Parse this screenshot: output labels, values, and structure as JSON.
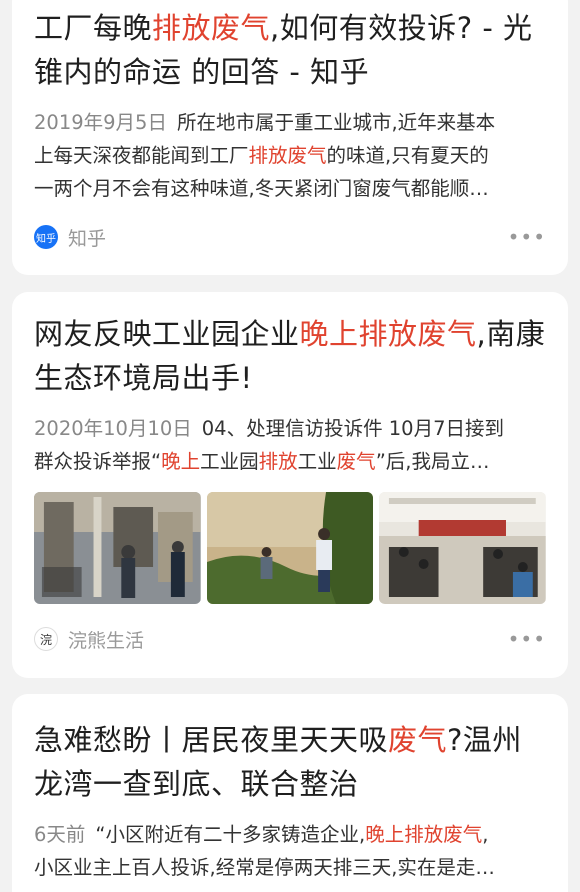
{
  "results": [
    {
      "title_parts": [
        "工厂每晚",
        "排放废气",
        ",如何有效投诉? - 光",
        "锥内的命运 的回答 - 知乎"
      ],
      "date": "2019年9月5日",
      "snippet_lines": [
        [
          "所在地市属于重工业城市,近年来基本"
        ],
        [
          "上每天深夜都能闻到工厂",
          "排放废气",
          "的味道,只有夏天的"
        ],
        [
          "一两个月不会有这种味道,冬天紧闭门窗废气都能顺…"
        ]
      ],
      "source_logo_text": "知乎",
      "source_name": "知乎",
      "more_label": "•••"
    },
    {
      "title_parts": [
        "网友反映工业园企业",
        "晚上排放废气",
        ",南康",
        "生态环境局出手!"
      ],
      "date": "2020年10月10日",
      "snippet_lines": [
        [
          "04、处理信访投诉件 10月7日接到"
        ],
        [
          "群众投诉举报“",
          "晚上",
          "工业园",
          "排放",
          "工业",
          "废气",
          "”后,我局立…"
        ]
      ],
      "source_logo_text": "浣",
      "source_name": "浣熊生活",
      "more_label": "•••"
    },
    {
      "title_parts": [
        "急难愁盼丨居民夜里天天吸",
        "废气",
        "?温州",
        "龙湾一查到底、联合整治"
      ],
      "date": "6天前",
      "snippet_lines": [
        [
          "“小区附近有二十多家铸造企业,",
          "晚上排放废气",
          ","
        ],
        [
          "小区业主上百人投诉,经常是停两天排三天,实在是走…"
        ]
      ]
    }
  ],
  "colors": {
    "highlight": "#e0432f",
    "zhihu_blue": "#1772f6"
  }
}
